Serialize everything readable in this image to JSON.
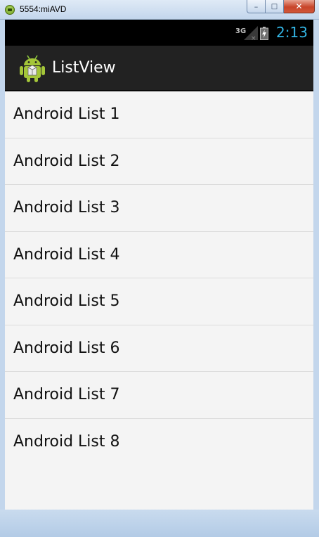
{
  "window": {
    "title": "5554:miAVD",
    "minimize_glyph": "–",
    "maximize_glyph": "□",
    "close_glyph": "✕"
  },
  "status_bar": {
    "network": "3G",
    "time": "2:13",
    "signal_icon": "signal-no-service-icon",
    "battery_icon": "battery-charging-icon",
    "time_color": "#33b5e5"
  },
  "action_bar": {
    "title": "ListView",
    "icon": "android-robot-icon",
    "background": "#222222"
  },
  "list": {
    "items": [
      {
        "label": "Android List 1"
      },
      {
        "label": "Android List 2"
      },
      {
        "label": "Android List 3"
      },
      {
        "label": "Android List 4"
      },
      {
        "label": "Android List 5"
      },
      {
        "label": "Android List 6"
      },
      {
        "label": "Android List 7"
      },
      {
        "label": "Android List 8"
      }
    ]
  }
}
